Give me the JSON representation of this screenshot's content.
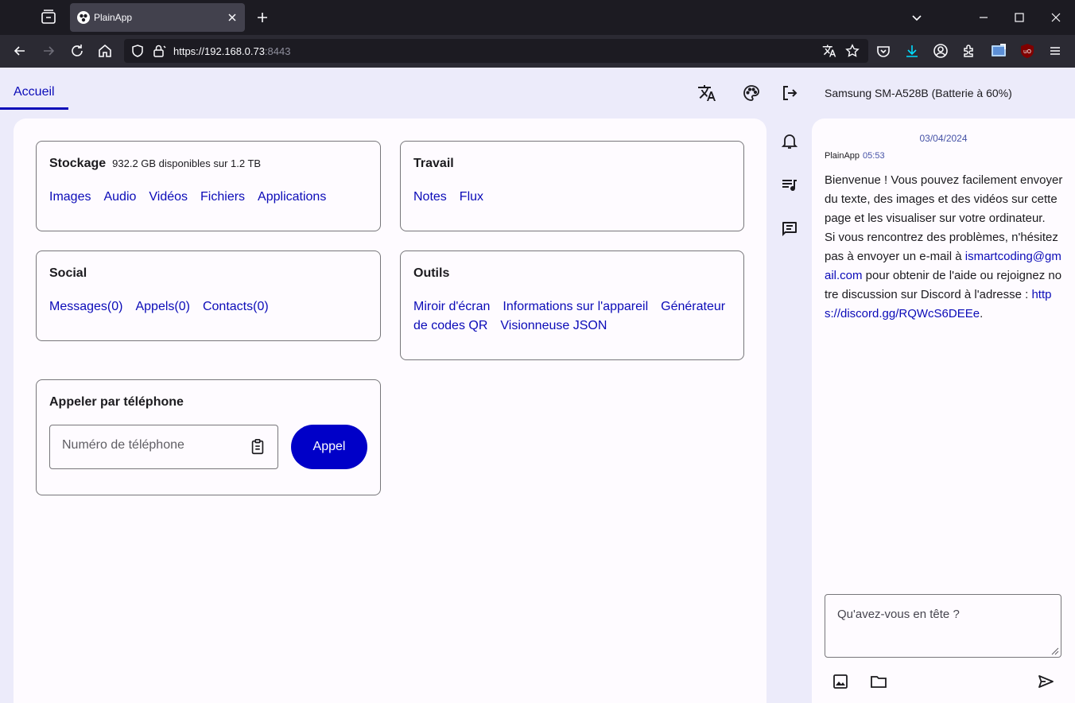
{
  "browser": {
    "tab_title": "PlainApp",
    "url_main": "https://192.168.0.73",
    "url_port": ":8443"
  },
  "app": {
    "home_tab": "Accueil",
    "device_label": "Samsung SM-A528B (Batterie à 60%)"
  },
  "cards": {
    "storage": {
      "title": "Stockage",
      "subtitle": "932.2 GB disponibles sur 1.2 TB",
      "links": [
        "Images",
        "Audio",
        "Vidéos",
        "Fichiers",
        "Applications"
      ]
    },
    "work": {
      "title": "Travail",
      "links": [
        "Notes",
        "Flux"
      ]
    },
    "social": {
      "title": "Social",
      "links": [
        "Messages(0)",
        "Appels(0)",
        "Contacts(0)"
      ]
    },
    "tools": {
      "title": "Outils",
      "links": [
        "Miroir d'écran",
        "Informations sur l'appareil",
        "Générateur de codes QR",
        "Visionneuse JSON"
      ]
    },
    "call": {
      "title": "Appeler par téléphone",
      "placeholder": "Numéro de téléphone",
      "button": "Appel"
    }
  },
  "chat": {
    "date": "03/04/2024",
    "sender": "PlainApp",
    "time": "05:53",
    "msg_part1": "Bienvenue ! Vous pouvez facilement envoyer du texte, des images et des vidéos sur cette page et les visualiser sur votre ordinateur.",
    "msg_part2": "Si vous rencontrez des problèmes, n'hésitez pas à envoyer un e-mail à ",
    "email": "ismartcoding@gmail.com",
    "msg_part3": " pour obtenir de l'aide ou rejoignez notre discussion sur Discord à l'adresse : ",
    "discord": "https://discord.gg/RQWcS6DEEe",
    "msg_end": ".",
    "placeholder": "Qu'avez-vous en tête ?"
  },
  "colors": {
    "accent": "#0b0bb8",
    "button": "#0000c8",
    "background": "#ecebfa",
    "panel": "#fefbff"
  }
}
